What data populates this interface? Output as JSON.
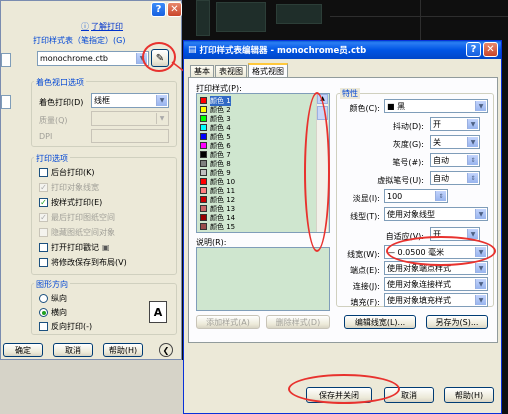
{
  "back_dialog": {
    "help_link": "了解打印",
    "plot_style_table_group": "打印样式表（笔指定）(G)",
    "plot_style_value": "monochrome.ctb",
    "shaded_viewport_group": "着色视口选项",
    "shade_plot_label": "着色打印(D)",
    "shade_plot_value": "线框",
    "quality_label": "质量(Q)",
    "dpi_label": "DPI",
    "plot_options_group": "打印选项",
    "options": [
      {
        "label": "后台打印(K)",
        "checked": false,
        "enabled": true
      },
      {
        "label": "打印对象线宽",
        "checked": true,
        "enabled": false
      },
      {
        "label": "按样式打印(E)",
        "checked": true,
        "enabled": true
      },
      {
        "label": "最后打印图纸空间",
        "checked": true,
        "enabled": false
      },
      {
        "label": "隐藏图纸空间对象",
        "checked": false,
        "enabled": false
      },
      {
        "label": "打开打印戳记",
        "checked": false,
        "enabled": true
      },
      {
        "label": "将修改保存到布局(V)",
        "checked": false,
        "enabled": true
      }
    ],
    "orientation_group": "图形方向",
    "portrait": "纵向",
    "landscape": "横向",
    "upside_down": "反向打印(-)",
    "ok": "确定",
    "cancel": "取消",
    "help": "帮助(H)"
  },
  "editor": {
    "title": "打印样式表编辑器 - monochrome员.ctb",
    "tabs": [
      "基本",
      "表视图",
      "格式视图"
    ],
    "styles_label": "打印样式(P):",
    "styles": [
      "颜色 1",
      "颜色 2",
      "颜色 3",
      "颜色 4",
      "颜色 5",
      "颜色 6",
      "颜色 7",
      "颜色 8",
      "颜色 9",
      "颜色 10",
      "颜色 11",
      "颜色 12",
      "颜色 13",
      "颜色 14",
      "颜色 15"
    ],
    "style_colors": [
      "#ff0000",
      "#ffff00",
      "#00ff00",
      "#00ffff",
      "#0000ff",
      "#ff00ff",
      "#000000",
      "#808080",
      "#c0c0c0",
      "#ff0000",
      "#ff7f7f",
      "#cc0000",
      "#cc6666",
      "#990000",
      "#994c4c"
    ],
    "description_label": "说明(R):",
    "add_style": "添加样式(A)",
    "delete_style": "删除样式(D)",
    "properties_title": "特性",
    "props": {
      "color_label": "颜色(C):",
      "color_value": "■ 黑",
      "dither_label": "抖动(D):",
      "dither_value": "开",
      "grayscale_label": "灰度(G):",
      "grayscale_value": "关",
      "pen_label": "笔号(#):",
      "pen_value": "自动",
      "vpen_label": "虚拟笔号(U):",
      "vpen_value": "自动",
      "screening_label": "淡显(I):",
      "screening_value": "100",
      "linetype_label": "线型(T):",
      "linetype_value": "使用对象线型",
      "adaptive_label": "自适应(V):",
      "adaptive_value": "开",
      "lineweight_label": "线宽(W):",
      "lineweight_value": "— 0.0500 毫米",
      "endstyle_label": "端点(E):",
      "endstyle_value": "使用对象端点样式",
      "joinstyle_label": "连接(J):",
      "joinstyle_value": "使用对象连接样式",
      "fillstyle_label": "填充(F):",
      "fillstyle_value": "使用对象填充样式"
    },
    "edit_lineweights": "编辑线宽(L)...",
    "save_as": "另存为(S)...",
    "save_close": "保存并关闭",
    "cancel": "取消",
    "help": "帮助(H)"
  }
}
